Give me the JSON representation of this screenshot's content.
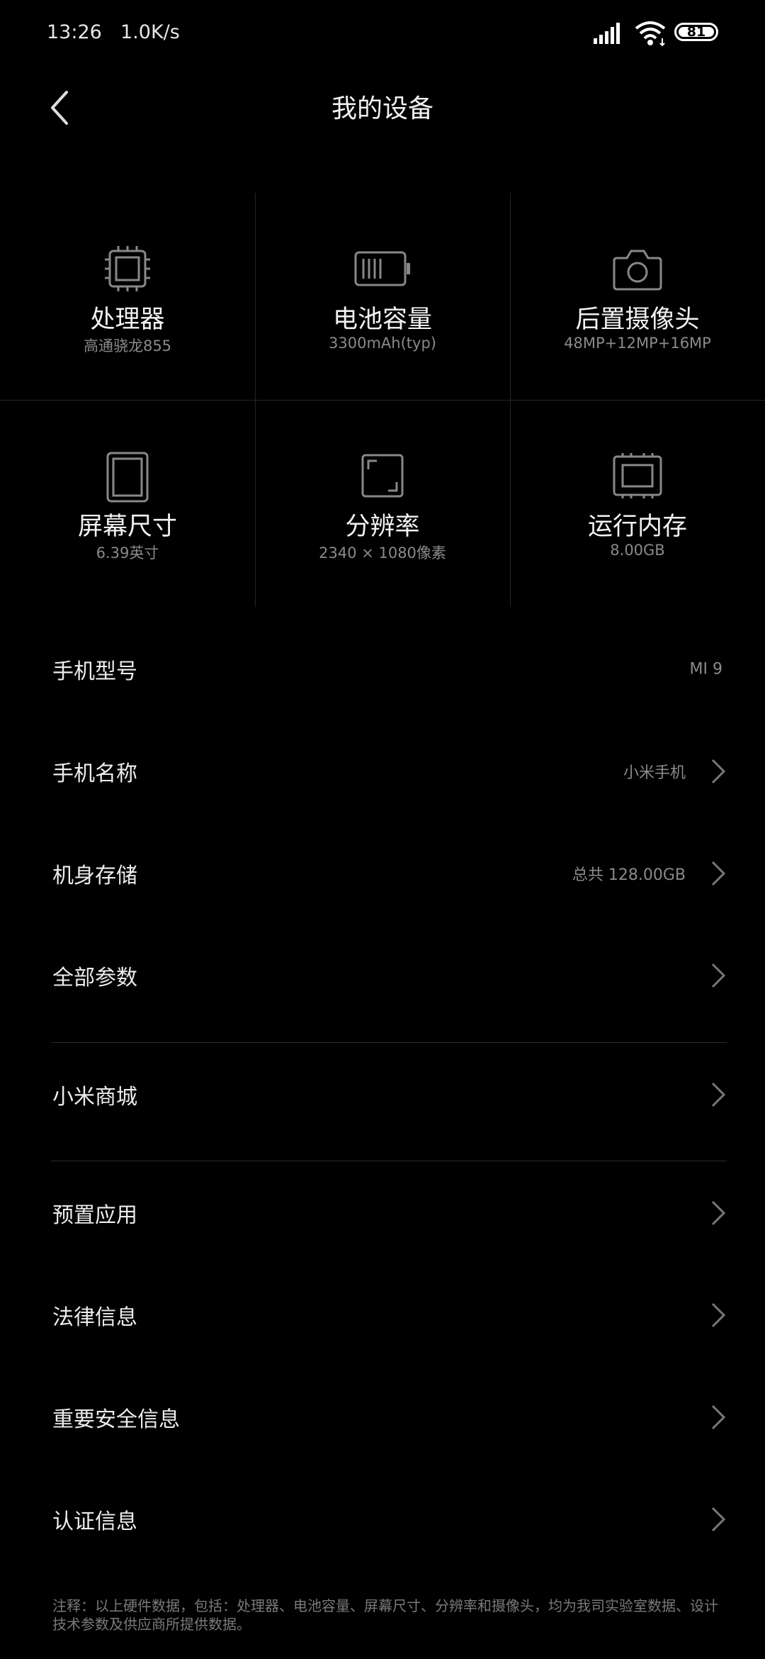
{
  "status_bar": {
    "time": "13:26",
    "net_speed": "1.0K/s",
    "battery_level": "81",
    "icons": [
      "signal-icon",
      "wifi-icon",
      "battery-icon"
    ]
  },
  "header": {
    "title": "我的设备",
    "back_icon": "chevron-left-icon"
  },
  "specs": [
    {
      "icon": "processor-icon",
      "title": "处理器",
      "value": "高通骁龙855"
    },
    {
      "icon": "battery-capacity-icon",
      "title": "电池容量",
      "value": "3300mAh(typ)"
    },
    {
      "icon": "camera-icon",
      "title": "后置摄像头",
      "value": "48MP+12MP+16MP"
    },
    {
      "icon": "screen-size-icon",
      "title": "屏幕尺寸",
      "value": "6.39英寸"
    },
    {
      "icon": "resolution-icon",
      "title": "分辨率",
      "value": "2340 × 1080像素"
    },
    {
      "icon": "ram-icon",
      "title": "运行内存",
      "value": "8.00GB"
    }
  ],
  "rows": [
    {
      "label": "手机型号",
      "value": "MI 9",
      "chevron": false
    },
    {
      "label": "手机名称",
      "value": "小米手机",
      "chevron": true
    },
    {
      "label": "机身存储",
      "value": "总共 128.00GB",
      "chevron": true
    },
    {
      "label": "全部参数",
      "value": "",
      "chevron": true
    },
    {
      "label": "小米商城",
      "value": "",
      "chevron": true
    },
    {
      "label": "预置应用",
      "value": "",
      "chevron": true
    },
    {
      "label": "法律信息",
      "value": "",
      "chevron": true
    },
    {
      "label": "重要安全信息",
      "value": "",
      "chevron": true
    },
    {
      "label": "认证信息",
      "value": "",
      "chevron": true
    }
  ],
  "footnote": "注释：以上硬件数据，包括：处理器、电池容量、屏幕尺寸、分辨率和摄像头，均为我司实验室数据、设计技术参数及供应商所提供数据。"
}
